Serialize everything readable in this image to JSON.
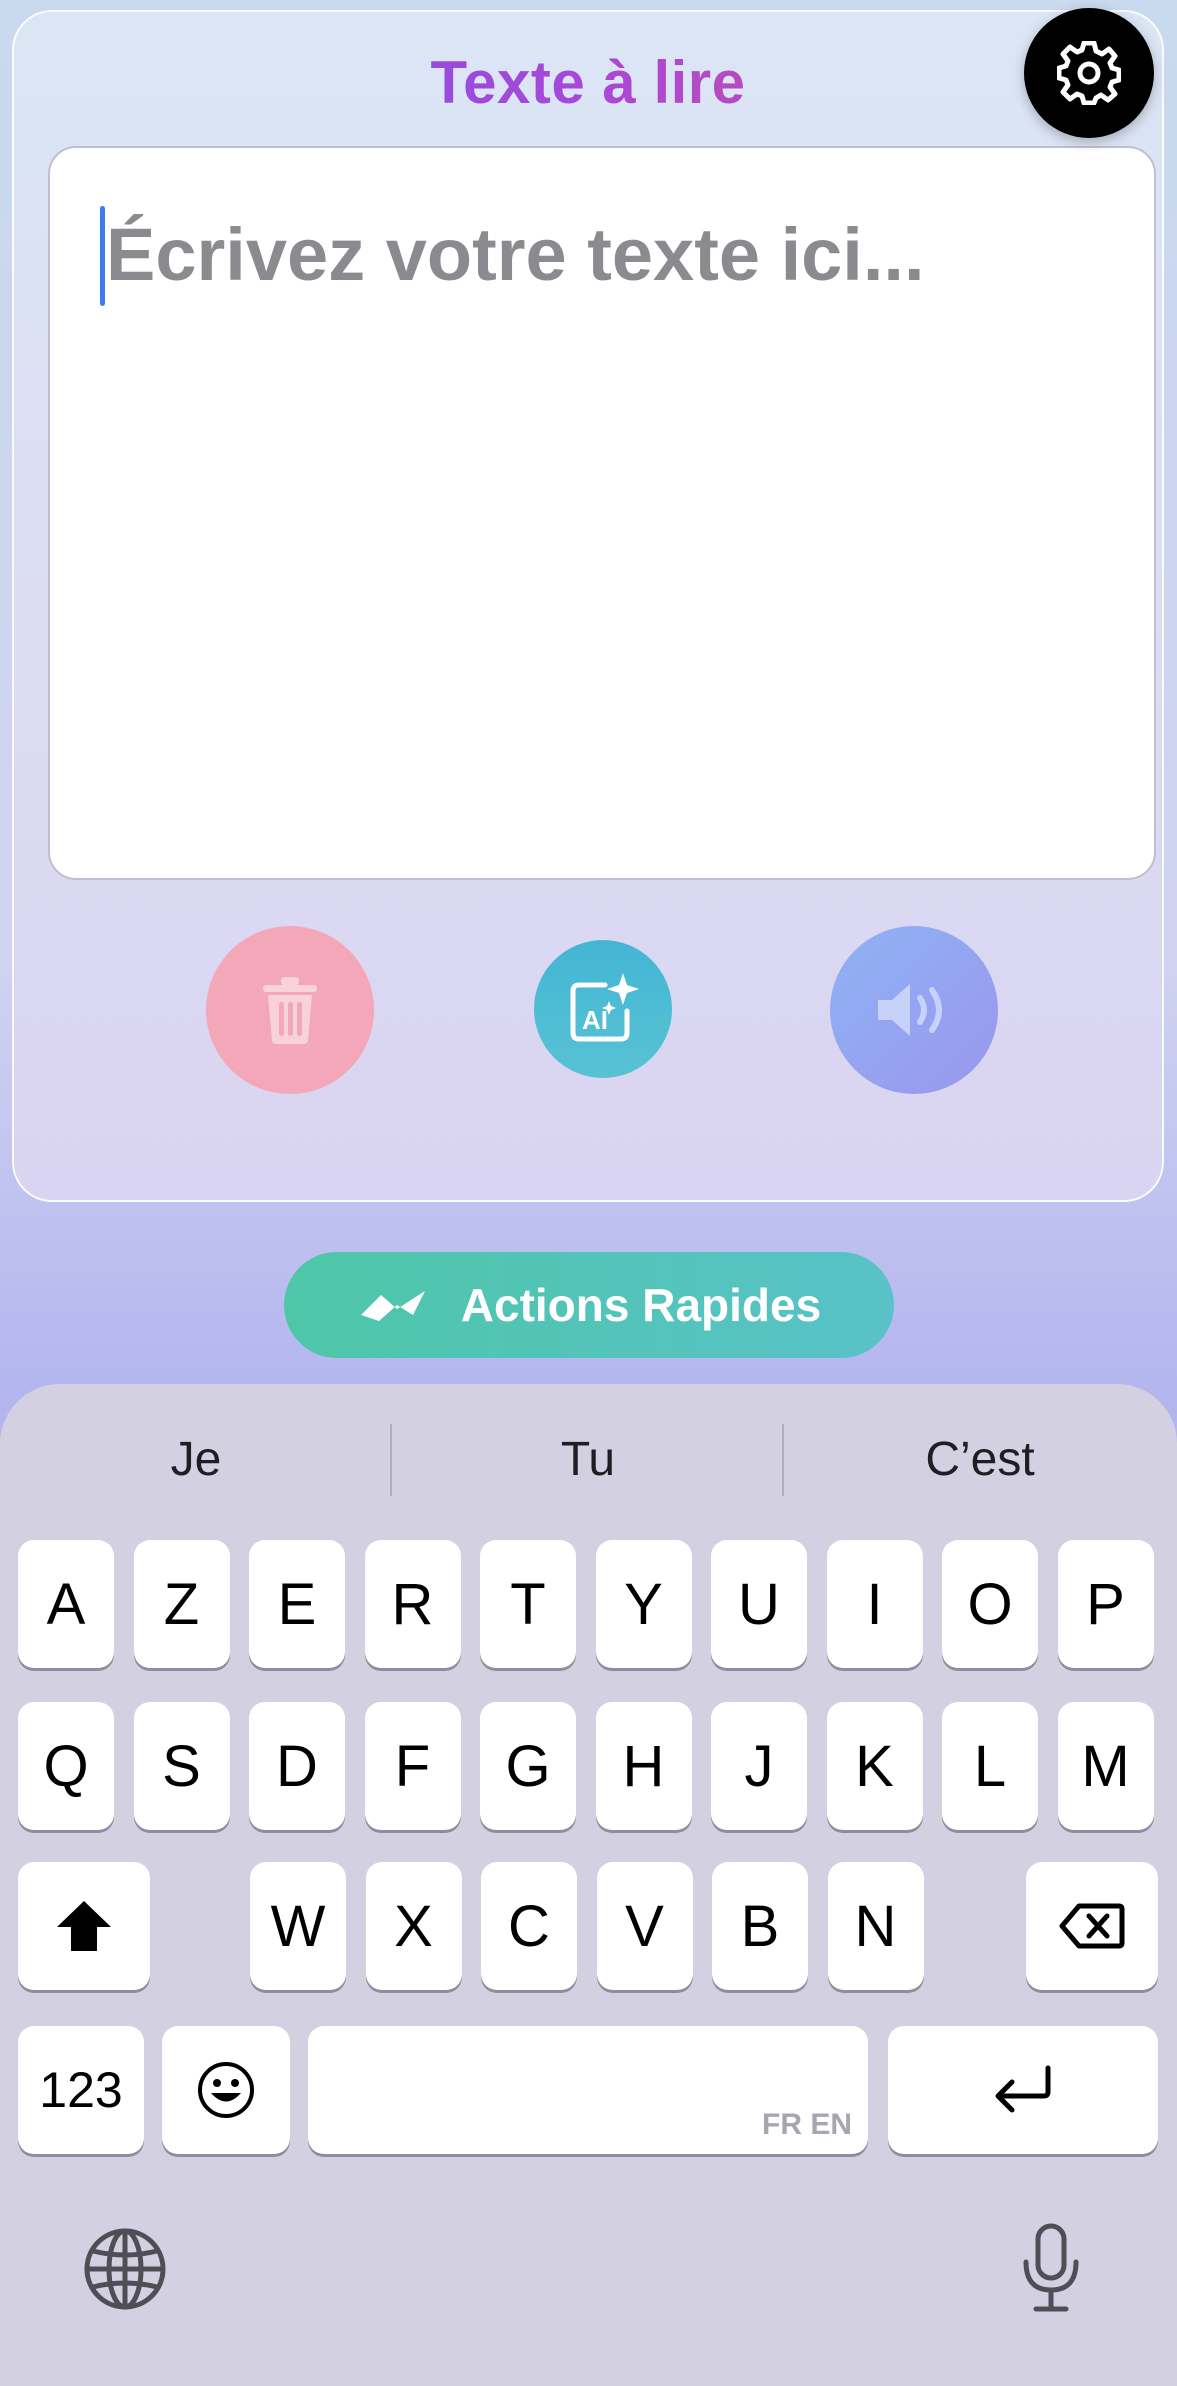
{
  "header": {
    "title": "Texte à lire"
  },
  "editor": {
    "placeholder": "Écrivez votre texte ici..."
  },
  "actions": {
    "delete": "trash-icon",
    "ai": "ai-sparkle-icon",
    "speak": "speaker-icon"
  },
  "quick_actions": {
    "label": "Actions Rapides",
    "icon": "wave-icon"
  },
  "keyboard": {
    "suggestions": [
      "Je",
      "Tu",
      "C’est"
    ],
    "row1": [
      "A",
      "Z",
      "E",
      "R",
      "T",
      "Y",
      "U",
      "I",
      "O",
      "P"
    ],
    "row2": [
      "Q",
      "S",
      "D",
      "F",
      "G",
      "H",
      "J",
      "K",
      "L",
      "M"
    ],
    "row3": [
      "W",
      "X",
      "C",
      "V",
      "B",
      "N"
    ],
    "numbers_label": "123",
    "language_hint": "FR EN"
  },
  "colors": {
    "title_gradient_start": "#6c55ea",
    "title_gradient_end": "#e2507a",
    "caret": "#3d7bf0",
    "delete_button": "#f3a7b8",
    "ai_button": "#43b6d4",
    "speak_button": "#9a96ee",
    "quick_actions": "#4ec6a8"
  }
}
